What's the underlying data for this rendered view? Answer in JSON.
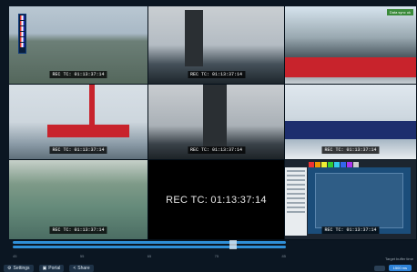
{
  "tiles": [
    {
      "id": "cam-1",
      "timecode": "REC TC: 01:13:37:14"
    },
    {
      "id": "cam-2",
      "timecode": "REC TC: 01:13:37:14"
    },
    {
      "id": "cam-3",
      "timecode": "",
      "badge": "Data sync ok"
    },
    {
      "id": "cam-4",
      "timecode": "REC TC: 01:13:37:14"
    },
    {
      "id": "cam-5",
      "timecode": "REC TC: 01:13:37:14"
    },
    {
      "id": "cam-6",
      "timecode": "REC TC: 01:13:37:14"
    },
    {
      "id": "cam-7",
      "timecode": "REC TC: 01:13:37:14"
    },
    {
      "id": "cam-8",
      "timecode": "REC TC: 01:13:37:14"
    },
    {
      "id": "cam-9",
      "timecode": "REC TC: 01:13:37:14"
    }
  ],
  "timeline": {
    "ticks": [
      "45",
      "55",
      "65",
      "75",
      "85"
    ],
    "right_label": "Target buffer time"
  },
  "buttons": {
    "settings": "Settings",
    "portal": "Portal",
    "share": "Share"
  },
  "zoom": {
    "value": "1500 ms"
  },
  "colors": {
    "accent": "#2f8fd8",
    "background": "#0b1622",
    "team_red": "#c8232c",
    "team_blue": "#1d2e6e"
  },
  "icons": {
    "settings": "gear-icon",
    "portal": "portal-icon",
    "share": "share-icon"
  }
}
